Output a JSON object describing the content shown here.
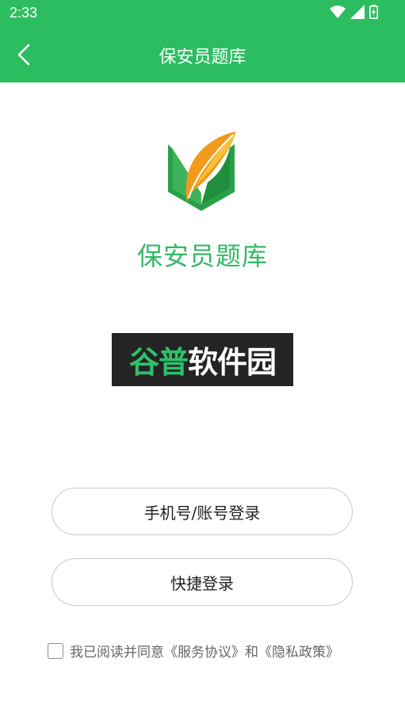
{
  "status_bar": {
    "time": "2:33",
    "icons": [
      "wifi-icon",
      "signal-icon",
      "battery-charging-icon"
    ]
  },
  "app_bar": {
    "title": "保安员题库",
    "back_icon": "chevron-left-icon"
  },
  "hero": {
    "app_name": "保安员题库",
    "logo_icon": "leaf-book-logo"
  },
  "watermark": {
    "part1": "谷普",
    "part2": "软件园"
  },
  "buttons": {
    "phone_login": "手机号/账号登录",
    "quick_login": "快捷登录"
  },
  "agreement": {
    "text": "我已阅读并同意《服务协议》和《隐私政策》",
    "checked": false
  },
  "colors": {
    "primary": "#2dbd61",
    "app_name": "#33b868",
    "logo_orange": "#f29a1b",
    "logo_green": "#27a148"
  }
}
